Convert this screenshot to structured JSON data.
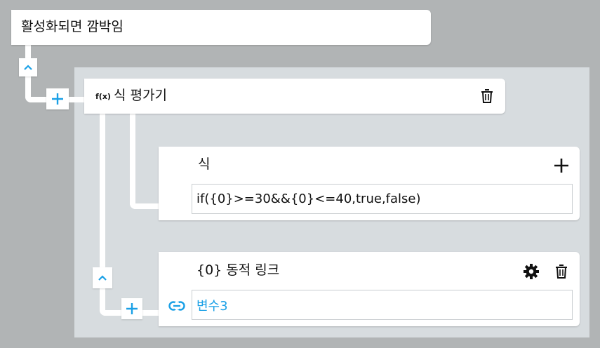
{
  "event_node": {
    "title": "활성화되면 깜박임"
  },
  "expression_node": {
    "fx_label": "f(x)",
    "title": "식 평가기"
  },
  "expression_input": {
    "label": "식",
    "value": "if({0}>=30&&{0}<=40,true,false)"
  },
  "link_node": {
    "title": "{0} 동적 링크",
    "value": "변수3"
  },
  "colors": {
    "accent": "#1aa0e6",
    "canvas": "#b1b4b5",
    "panel": "#d7dcdf"
  },
  "icons": [
    "chevron-up-icon",
    "plus-icon",
    "trash-icon",
    "gear-icon",
    "link-icon"
  ]
}
